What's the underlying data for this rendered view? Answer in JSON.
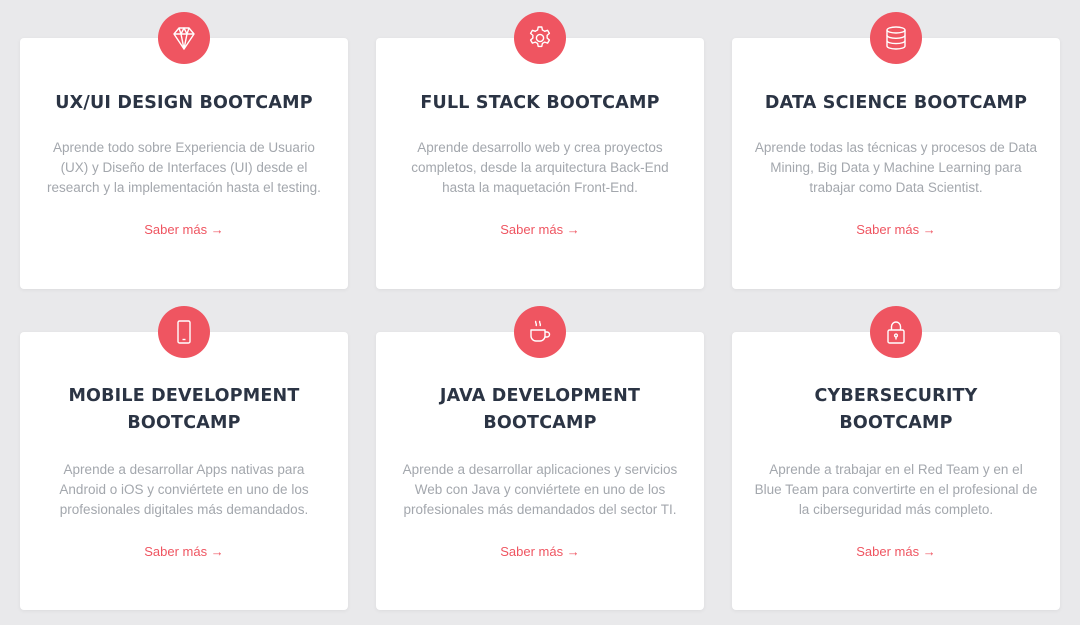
{
  "accent_color": "#ef5561",
  "cards": [
    {
      "icon": "diamond-icon",
      "title": "UX/UI DESIGN BOOTCAMP",
      "description": "Aprende todo sobre Experiencia de Usuario (UX) y Diseño de Interfaces (UI) desde el research y la implementación hasta el testing.",
      "link": "Saber más →"
    },
    {
      "icon": "gear-icon",
      "title": "FULL STACK BOOTCAMP",
      "description": "Aprende desarrollo web y crea proyectos completos, desde la arquitectura Back-End hasta la maquetación Front-End.",
      "link": "Saber más →"
    },
    {
      "icon": "database-icon",
      "title": "DATA SCIENCE BOOTCAMP",
      "description": "Aprende todas las técnicas y procesos de Data Mining, Big Data y Machine Learning para trabajar como Data Scientist.",
      "link": "Saber más →"
    },
    {
      "icon": "smartphone-icon",
      "title": "MOBILE DEVELOPMENT BOOTCAMP",
      "description": "Aprende a desarrollar Apps nativas para Android o iOS y conviértete en uno de los profesionales digitales más demandados.",
      "link": "Saber más →"
    },
    {
      "icon": "coffee-cup-icon",
      "title": "JAVA DEVELOPMENT BOOTCAMP",
      "description": "Aprende a desarrollar aplicaciones y servicios Web con Java y conviértete en uno de los profesionales más demandados del sector TI.",
      "link": "Saber más →"
    },
    {
      "icon": "padlock-icon",
      "title": "CYBERSECURITY BOOTCAMP",
      "description": "Aprende a trabajar en el Red Team y en el Blue Team para convertirte en el profesional de la ciberseguridad más completo.",
      "link": "Saber más →"
    }
  ]
}
